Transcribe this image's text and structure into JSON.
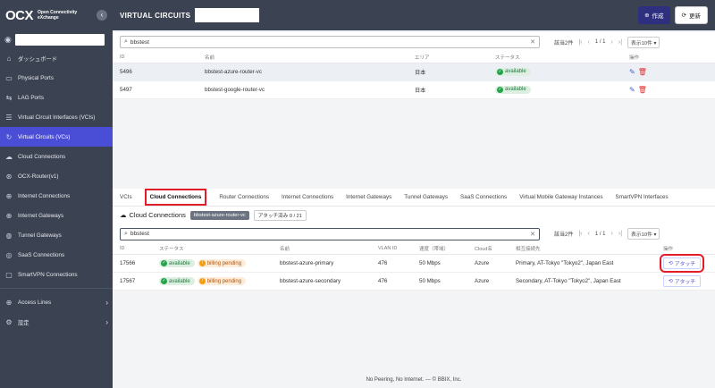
{
  "brand": {
    "logo": "OCX",
    "name_line1": "Open Connectivity",
    "name_line2": "eXchange",
    "collapse_icon": "chevron-left-icon"
  },
  "sidebar": {
    "items": [
      {
        "label": "ダッシュボード",
        "icon": "home-icon"
      },
      {
        "label": "Physical Ports",
        "icon": "port-icon"
      },
      {
        "label": "LAG Ports",
        "icon": "lag-icon"
      },
      {
        "label": "Virtual Circuit Interfaces (VCIs)",
        "icon": "sliders-icon"
      },
      {
        "label": "Virtual Circuits (VCs)",
        "icon": "circuit-icon"
      },
      {
        "label": "Cloud Connections",
        "icon": "cloud-icon"
      },
      {
        "label": "OCX-Router(v1)",
        "icon": "router-icon"
      },
      {
        "label": "Internet Connections",
        "icon": "globe-icon"
      },
      {
        "label": "Internet Gateways",
        "icon": "globe-icon"
      },
      {
        "label": "Tunnel Gateways",
        "icon": "tunnel-icon"
      },
      {
        "label": "SaaS Connections",
        "icon": "saas-icon"
      },
      {
        "label": "SmartVPN Connections",
        "icon": "vpn-icon"
      }
    ],
    "bottom": [
      {
        "label": "Access Lines",
        "icon": "globe-icon"
      },
      {
        "label": "設定",
        "icon": "gear-icon"
      }
    ]
  },
  "header": {
    "title": "VIRTUAL CIRCUITS",
    "create_label": "作成",
    "refresh_label": "更新"
  },
  "vc_search": {
    "value": "bbstest",
    "count": "該当2件",
    "page": "1 / 1",
    "per_page": "表示10件"
  },
  "vc_table": {
    "headers": [
      "ID",
      "名前",
      "エリア",
      "ステータス",
      "操作"
    ],
    "rows": [
      {
        "id": "5496",
        "name": "bbstest-azure-router-vc",
        "area": "日本",
        "status": "available"
      },
      {
        "id": "5497",
        "name": "bbstest-google-router-vc",
        "area": "日本",
        "status": "available"
      }
    ]
  },
  "tabs": [
    "VCIs",
    "Cloud Connections",
    "Router Connections",
    "Internet Connections",
    "Internet Gateways",
    "Tunnel Gateways",
    "SaaS Connections",
    "Virtual Mobile Gateway Instances",
    "SmartVPN Interfaces"
  ],
  "cc": {
    "title": "Cloud Connections",
    "vc_chip": "bbstest-azure-router-vc",
    "attached": "アタッチ済み 0 / 21"
  },
  "cc_search": {
    "value": "bbstest",
    "count": "該当2件",
    "page": "1 / 1",
    "per_page": "表示10件"
  },
  "cc_table": {
    "headers": [
      "ID",
      "ステータス",
      "名前",
      "VLAN ID",
      "速度（帯域）",
      "Cloud名",
      "相互接続先",
      "操作"
    ],
    "rows": [
      {
        "id": "17566",
        "status": "available",
        "billing": "billing pending",
        "name": "bbstest-azure-primary",
        "vlan": "476",
        "speed": "50 Mbps",
        "cloud": "Azure",
        "peer": "Primary, AT-Tokyo \"Tokyo2\", Japan East",
        "action": "アタッチ"
      },
      {
        "id": "17567",
        "status": "available",
        "billing": "billing pending",
        "name": "bbstest-azure-secondary",
        "vlan": "476",
        "speed": "50 Mbps",
        "cloud": "Azure",
        "peer": "Secondary, AT-Tokyo \"Tokyo2\", Japan East",
        "action": "アタッチ"
      }
    ]
  },
  "footer": "No Peering, No Internet. --- © BBIX, Inc."
}
